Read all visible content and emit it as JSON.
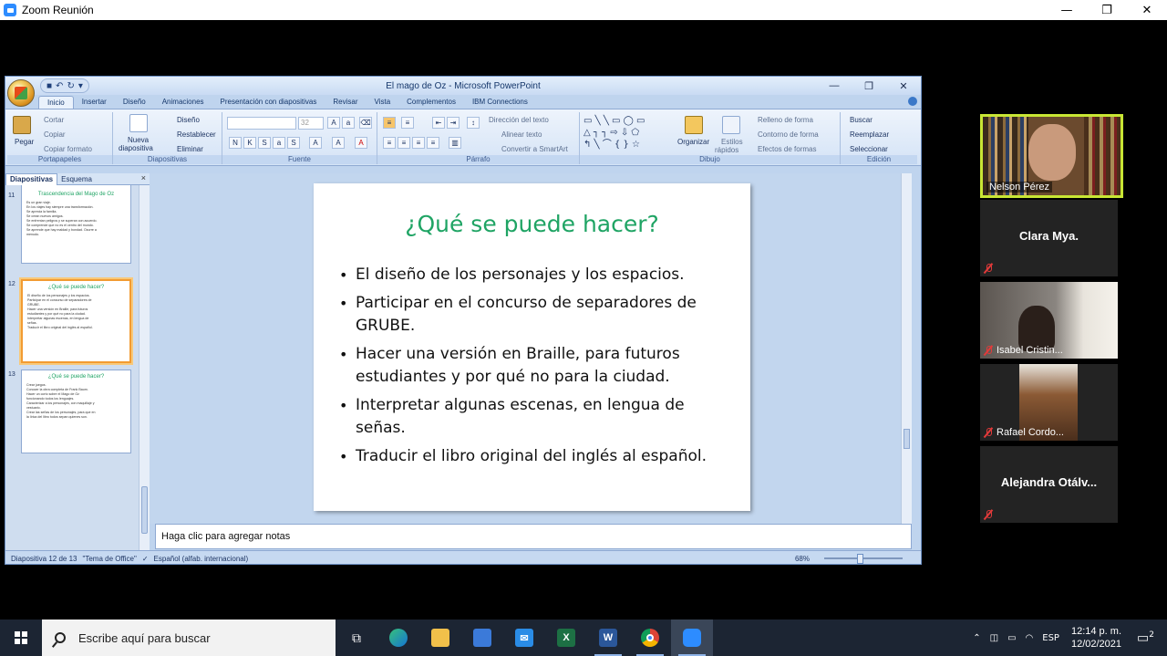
{
  "zoom": {
    "title": "Zoom Reunión",
    "controls": [
      "—",
      "❐",
      "✕"
    ]
  },
  "ppt": {
    "title": "El mago de Oz - Microsoft PowerPoint",
    "controls": [
      "—",
      "❐",
      "✕"
    ],
    "tabs": [
      "Inicio",
      "Insertar",
      "Diseño",
      "Animaciones",
      "Presentación con diapositivas",
      "Revisar",
      "Vista",
      "Complementos",
      "IBM Connections"
    ],
    "ribbon": {
      "portapapeles": {
        "label": "Portapapeles",
        "pegar": "Pegar",
        "cortar": "Cortar",
        "copiar": "Copiar",
        "copiar_formato": "Copiar formato"
      },
      "diapositivas": {
        "label": "Diapositivas",
        "nueva": "Nueva",
        "nueva2": "diapositiva",
        "diseno": "Diseño",
        "restablecer": "Restablecer",
        "eliminar": "Eliminar"
      },
      "fuente": {
        "label": "Fuente",
        "size": "32"
      },
      "parrafo": {
        "label": "Párrafo",
        "direccion": "Dirección del texto",
        "alinear": "Alinear texto",
        "convertir": "Convertir a SmartArt"
      },
      "dibujo": {
        "label": "Dibujo",
        "organizar": "Organizar",
        "estilos": "Estilos",
        "estilos2": "rápidos",
        "relleno": "Relleno de forma",
        "contorno": "Contorno de forma",
        "efectos": "Efectos de formas"
      },
      "edicion": {
        "label": "Edición",
        "buscar": "Buscar",
        "reemplazar": "Reemplazar",
        "seleccionar": "Seleccionar"
      }
    },
    "left_panel": {
      "tab_slides": "Diapositivas",
      "tab_outline": "Esquema",
      "close": "×",
      "thumbnails": [
        {
          "num": "11",
          "title": "Trascendencia del Mago de Oz",
          "lines": [
            "Es un gran viaje.",
            "En los viajes hay siempre una transformación.",
            "Se aprecia la familia.",
            "Se crean nuevos amigos.",
            "Se enfrentan peligros y se superan con acuerdo.",
            "Se comprende que no es el centro del mundo.",
            "Se aprende que hay maldad y bondad. Ocurre a",
            "menudo."
          ]
        },
        {
          "num": "12",
          "title": "¿Qué se puede hacer?",
          "lines": [
            "El diseño de los personajes y los espacios.",
            "Participar en el concurso de separadores de",
            "GRUBE.",
            "Hacer una versión en Braille, para futuros",
            "estudiantes y por qué no para la ciudad.",
            "Interpretar algunas escenas, en lengua de",
            "señas.",
            "Traducir el libro original del inglés al español."
          ]
        },
        {
          "num": "13",
          "title": "¿Qué se puede hacer?",
          "lines": [
            "Crear juegos.",
            "Conocer la obra completa de Frank Baum.",
            "Hacer un corto sobre el Mago de Oz",
            "funcionando todos los lenguajes.",
            "Caracterizar a los personajes, con maquillaje y",
            "vestuario.",
            "Crear las señas de los personajes, para que en",
            "la lírica del libro todos sepan quienes son."
          ]
        }
      ]
    },
    "slide": {
      "title": "¿Qué se puede hacer?",
      "bullets": [
        "El diseño de los personajes y los espacios.",
        "Participar en el concurso de separadores de GRUBE.",
        "Hacer una versión en Braille, para futuros estudiantes y por qué no para la ciudad.",
        "Interpretar algunas escenas, en lengua de señas.",
        "Traducir el libro original del inglés al español."
      ]
    },
    "notes_placeholder": "Haga clic para agregar notas",
    "status": {
      "slide": "Diapositiva 12 de 13",
      "theme": "\"Tema de Office\"",
      "language": "Español (alfab. internacional)",
      "zoom": "68%"
    }
  },
  "participants": [
    {
      "name": "Nelson Pérez",
      "has_video": true,
      "active": true,
      "muted": false
    },
    {
      "name": "Clara Mya.",
      "label": "",
      "has_video": false,
      "muted": true
    },
    {
      "name": "Isabel Cristin...",
      "has_video": true,
      "muted": true
    },
    {
      "name": "Rafael Cordo...",
      "has_video": true,
      "muted": true
    },
    {
      "name": "Alejandra  Otálv...",
      "label": "",
      "has_video": false,
      "muted": true
    }
  ],
  "taskbar": {
    "search_placeholder": "Escribe aquí para buscar",
    "language": "ESP",
    "time": "12:14 p. m.",
    "date": "12/02/2021",
    "notifications": "2"
  },
  "colors": {
    "slide_title": "#1fa464",
    "active_speaker_border": "#c8e634",
    "zoom_blue": "#2d8cff"
  }
}
